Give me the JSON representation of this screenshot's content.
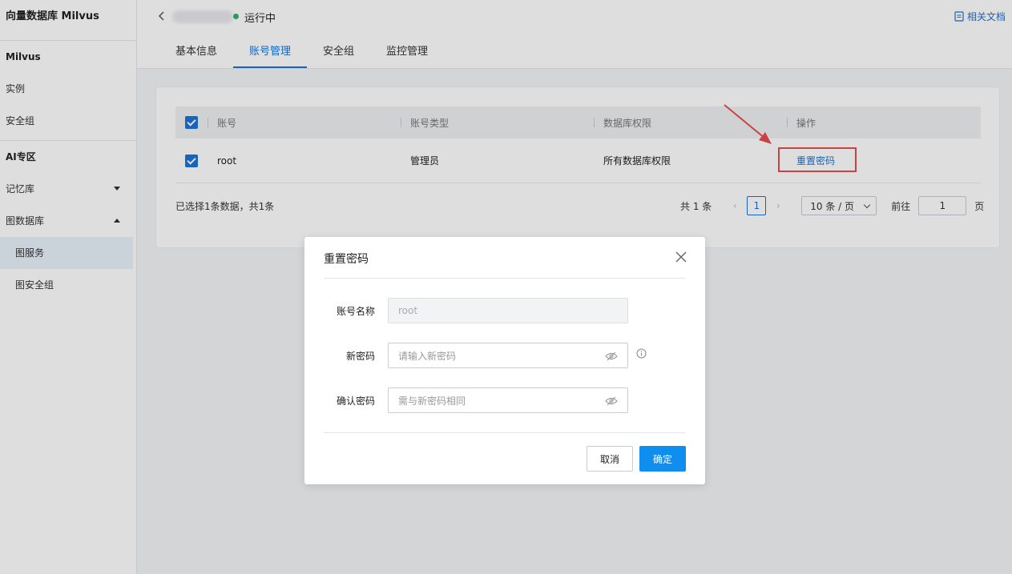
{
  "sidebar": {
    "title": "向量数据库 Milvus",
    "groups": [
      {
        "label": "Milvus",
        "items": [
          "实例",
          "安全组"
        ]
      },
      {
        "label": "AI专区"
      }
    ],
    "memory_lib": "记忆库",
    "graph_db": "图数据库",
    "graph_service": "图服务",
    "graph_security_group": "图安全组"
  },
  "header": {
    "status": "运行中",
    "doc_link": "相关文档",
    "tabs": [
      "基本信息",
      "账号管理",
      "安全组",
      "监控管理"
    ],
    "active_tab": 1
  },
  "table": {
    "columns": [
      "账号",
      "账号类型",
      "数据库权限",
      "操作"
    ],
    "rows": [
      {
        "account": "root",
        "type": "管理员",
        "permission": "所有数据库权限",
        "action": "重置密码"
      }
    ]
  },
  "footer": {
    "selection_info": "已选择1条数据，共1条",
    "total": "共 1 条",
    "current_page": "1",
    "page_size": "10 条 / 页",
    "goto_label": "前往",
    "goto_value": "1",
    "page_suffix": "页"
  },
  "modal": {
    "title": "重置密码",
    "account_label": "账号名称",
    "account_value": "root",
    "new_password_label": "新密码",
    "new_password_placeholder": "请输入新密码",
    "confirm_password_label": "确认密码",
    "confirm_password_placeholder": "需与新密码相同",
    "cancel": "取消",
    "ok": "确定"
  },
  "colors": {
    "primary": "#1a73d9",
    "ok_button": "#0f8ef0",
    "highlight": "#e84d4d",
    "status_running": "#2fb26a"
  }
}
